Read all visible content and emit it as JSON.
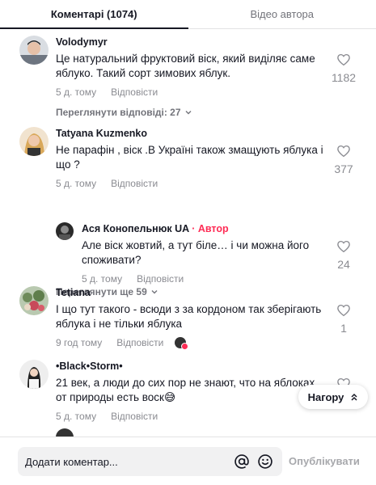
{
  "tabs": [
    {
      "label": "Коментарі (1074)"
    },
    {
      "label": "Відео автора"
    }
  ],
  "comments": [
    {
      "username": "Volodymyr",
      "text": "Це натуральний фруктовий віск, який виділяє саме яблуко. Такий сорт зимових яблук.",
      "time": "5 д. тому",
      "reply_label": "Відповісти",
      "likes": "1182",
      "view_replies": "Переглянути відповіді: 27"
    },
    {
      "username": "Tatyana Kuzmenko",
      "text": "Не парафін , віск .В Україні також змащують яблука і що ?",
      "time": "5 д. тому",
      "reply_label": "Відповісти",
      "likes": "377",
      "reply": {
        "username": "Ася Конопельнюк UA",
        "separator": "·",
        "badge": "Автор",
        "text": "Але віск жовтий, а тут біле… і чи можна його споживати?",
        "time": "5 д. тому",
        "reply_label": "Відповісти",
        "likes": "24"
      },
      "view_more": "Переглянути ще 59"
    },
    {
      "username": "Tetiana",
      "text": "І що тут такого - всюди з за кордоном так зберігають яблука і не тільки яблука",
      "time": "9 год тому",
      "reply_label": "Відповісти",
      "likes": "1"
    },
    {
      "username": "•Black•Storm•",
      "text": "21 век, а люди до сих пор не знают, что на яблоках от природы есть воск😅",
      "time": "5 д. тому",
      "reply_label": "Відповісти"
    }
  ],
  "back_to_top": "Нагору",
  "footer": {
    "placeholder": "Додати коментар...",
    "post_label": "Опублікувати"
  },
  "colors": {
    "accent": "#fe2c55",
    "muted": "#8a8b91",
    "text": "#161823"
  }
}
